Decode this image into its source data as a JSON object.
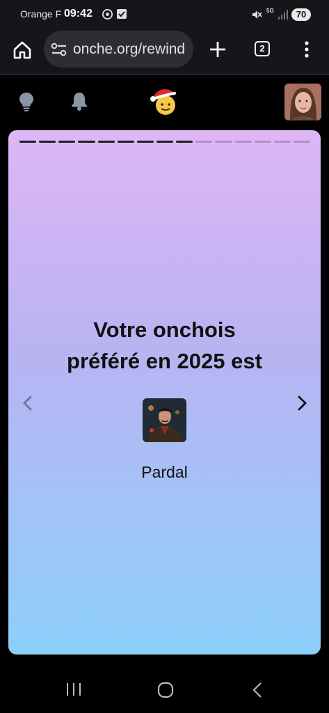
{
  "status_bar": {
    "carrier": "Orange F",
    "time": "09:42",
    "network": "5G",
    "battery": "70"
  },
  "browser": {
    "url": "onche.org/rewind",
    "tab_count": "2"
  },
  "site_header": {
    "icons": [
      "lightbulb-icon",
      "bell-icon",
      "santa-smiley-logo",
      "user-avatar"
    ]
  },
  "story": {
    "progress": {
      "total_segments": 15,
      "completed_segments": 9
    },
    "headline_line1": "Votre onchois",
    "headline_line2": "préféré en 2025 est",
    "winner_name": "Pardal",
    "gradient_top": "#deb6f6",
    "gradient_bottom": "#8ccffa"
  }
}
